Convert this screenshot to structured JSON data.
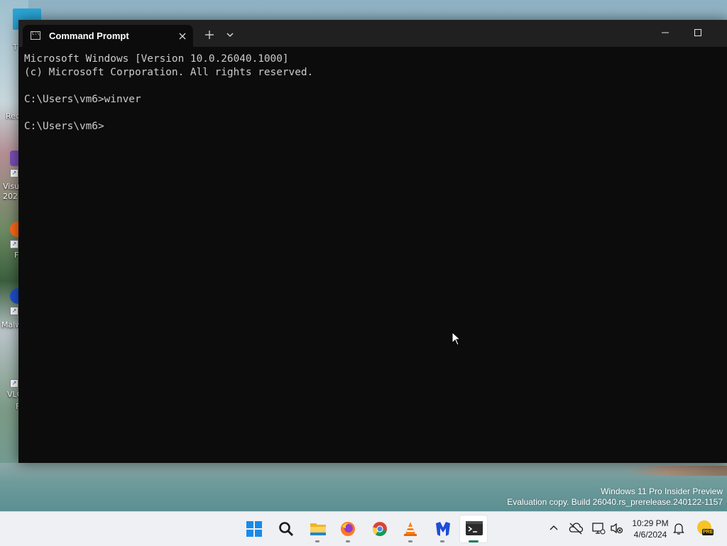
{
  "window": {
    "tab_title": "Command Prompt",
    "icons": {
      "tab": "cmd-icon",
      "close_tab": "close-icon",
      "new_tab": "plus-icon",
      "dropdown": "chevron-down-icon",
      "minimize": "minimize-icon",
      "maximize": "maximize-icon"
    }
  },
  "console": {
    "lines": [
      "Microsoft Windows [Version 10.0.26040.1000]",
      "(c) Microsoft Corporation. All rights reserved.",
      "",
      "C:\\Users\\vm6>winver",
      "",
      "C:\\Users\\vm6>"
    ]
  },
  "desktop": {
    "labels": [
      "T",
      "Rec",
      "Visu",
      "202",
      "F",
      "Malw",
      "VLC",
      "F"
    ]
  },
  "watermark": {
    "line1": "Windows 11 Pro Insider Preview",
    "line2": "Evaluation copy. Build 26040.rs_prerelease.240122-1157"
  },
  "taskbar": {
    "apps": [
      {
        "name": "start-button",
        "icon": "windows-logo-icon"
      },
      {
        "name": "search-button",
        "icon": "search-icon"
      },
      {
        "name": "file-explorer-app",
        "icon": "folder-icon"
      },
      {
        "name": "firefox-app",
        "icon": "firefox-icon"
      },
      {
        "name": "chrome-app",
        "icon": "chrome-icon"
      },
      {
        "name": "vlc-app",
        "icon": "vlc-cone-icon"
      },
      {
        "name": "malwarebytes-app",
        "icon": "malwarebytes-icon"
      },
      {
        "name": "terminal-app",
        "icon": "terminal-icon"
      }
    ],
    "tray": {
      "time": "10:29 PM",
      "date": "4/6/2024",
      "icons": [
        "chevron-up-icon",
        "cloud-off-icon",
        "network-icon",
        "volume-muted-icon",
        "bell-icon",
        "pre-badge-icon"
      ],
      "pre_badge": "PRE"
    }
  },
  "colors": {
    "console_bg": "#0c0c0c",
    "console_text": "#cccccc",
    "titlebar": "#202020",
    "taskbar": "#eef0f3",
    "accent": "#1a7f5a"
  }
}
